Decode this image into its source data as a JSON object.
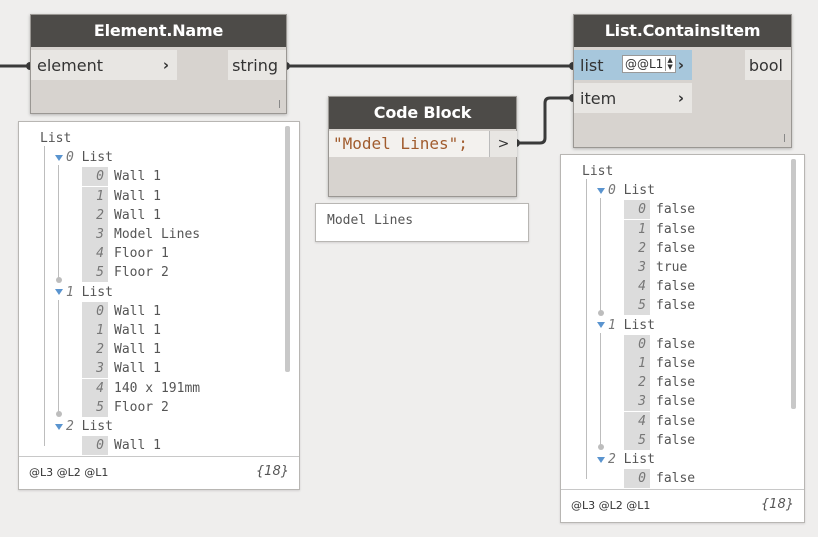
{
  "nodes": {
    "element_name": {
      "title": "Element.Name",
      "input": "element",
      "output": "string"
    },
    "code_block": {
      "title": "Code Block",
      "code": "\"Model Lines\";",
      "output_glyph": ">",
      "preview": "Model Lines"
    },
    "contains_item": {
      "title": "List.ContainsItem",
      "input_list": "list",
      "input_item": "item",
      "lacing": "@@L1",
      "output": "bool"
    }
  },
  "watch_left": {
    "root": "List",
    "groups": [
      {
        "index": "0",
        "label": "List",
        "items": [
          {
            "i": "0",
            "v": "Wall 1"
          },
          {
            "i": "1",
            "v": "Wall 1"
          },
          {
            "i": "2",
            "v": "Wall 1"
          },
          {
            "i": "3",
            "v": "Model Lines"
          },
          {
            "i": "4",
            "v": "Floor 1"
          },
          {
            "i": "5",
            "v": "Floor 2"
          }
        ]
      },
      {
        "index": "1",
        "label": "List",
        "items": [
          {
            "i": "0",
            "v": "Wall 1"
          },
          {
            "i": "1",
            "v": "Wall 1"
          },
          {
            "i": "2",
            "v": "Wall 1"
          },
          {
            "i": "3",
            "v": "Wall 1"
          },
          {
            "i": "4",
            "v": "140 x 191mm"
          },
          {
            "i": "5",
            "v": "Floor 2"
          }
        ]
      },
      {
        "index": "2",
        "label": "List",
        "items": [
          {
            "i": "0",
            "v": "Wall 1"
          }
        ]
      }
    ],
    "levels": "@L3 @L2 @L1",
    "count": "{18}"
  },
  "watch_right": {
    "root": "List",
    "groups": [
      {
        "index": "0",
        "label": "List",
        "items": [
          {
            "i": "0",
            "v": "false"
          },
          {
            "i": "1",
            "v": "false"
          },
          {
            "i": "2",
            "v": "false"
          },
          {
            "i": "3",
            "v": "true"
          },
          {
            "i": "4",
            "v": "false"
          },
          {
            "i": "5",
            "v": "false"
          }
        ]
      },
      {
        "index": "1",
        "label": "List",
        "items": [
          {
            "i": "0",
            "v": "false"
          },
          {
            "i": "1",
            "v": "false"
          },
          {
            "i": "2",
            "v": "false"
          },
          {
            "i": "3",
            "v": "false"
          },
          {
            "i": "4",
            "v": "false"
          },
          {
            "i": "5",
            "v": "false"
          }
        ]
      },
      {
        "index": "2",
        "label": "List",
        "items": [
          {
            "i": "0",
            "v": "false"
          }
        ]
      }
    ],
    "levels": "@L3 @L2 @L1",
    "count": "{18}"
  },
  "colors": {
    "node_header": "#4d4b48",
    "node_body": "#d7d3cf",
    "active_port": "#a7c7dc",
    "wire": "#3a3a3a",
    "code_string": "#a15c2e",
    "tree_triangle": "#5a94cf"
  }
}
